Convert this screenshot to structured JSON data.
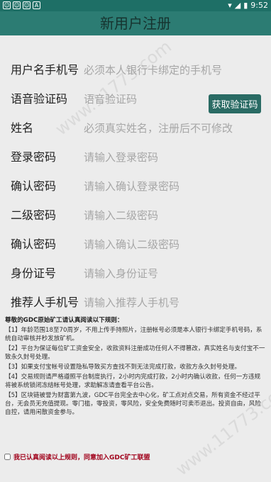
{
  "status": {
    "time": "9:52"
  },
  "title": "新用户注册",
  "fields": [
    {
      "label": "用户名手机号",
      "placeholder": "必须本人银行卡绑定的手机号"
    },
    {
      "label": "语音验证码",
      "placeholder": "语音验证码"
    },
    {
      "label": "姓名",
      "placeholder": "必须真实姓名，注册后不可修改"
    },
    {
      "label": "登录密码",
      "placeholder": "请输入登录密码"
    },
    {
      "label": "确认密码",
      "placeholder": "请输入确认登录密码"
    },
    {
      "label": "二级密码",
      "placeholder": "请输入二级密码"
    },
    {
      "label": "确认密码",
      "placeholder": "请输入确认二级密码"
    },
    {
      "label": "身份证号",
      "placeholder": "请输入身份证号"
    },
    {
      "label": "推荐人手机号",
      "placeholder": "请输入推荐人手机号"
    }
  ],
  "get_code_button": "获取验证码",
  "notice": {
    "title": "尊敬的GDC原始矿工请认真阅读以下规则：",
    "items": [
      "【1】年龄范围18至70周岁，不用上传手持照片，注册帐号必须是本人银行卡绑定手机号码，系统自动审核并秒发放矿机。",
      "【2】平台为保证每位矿工资金安全，收款资料注册成功任何人不得篡改，真实姓名与支付宝不一致永久封号处理。",
      "【3】如果支付宝帐号设置隐私导致买方查找不到无法完成打款，收款方永久封号处理。",
      "【4】交易规则请严格遵照平台制度执行，2小时内完成打款，2小时内确认收款，任何一方违规将被系统锁闭冻结帐号处理，求助解冻请查看平台公告。",
      "【5】区块链被誉为财富第九波，GDC平台完全去中心化，矿工点对点交易，所有资金不经过平台，无会员无充值提现。零门槛，零投资，零风险，安全免费随时可卖币退出。投资自由，风险自控，请用闲散资金参与。"
    ]
  },
  "agree_text": "我已认真阅读以上规则，同意加入GDC矿工联盟",
  "watermark": "www.11773.com"
}
